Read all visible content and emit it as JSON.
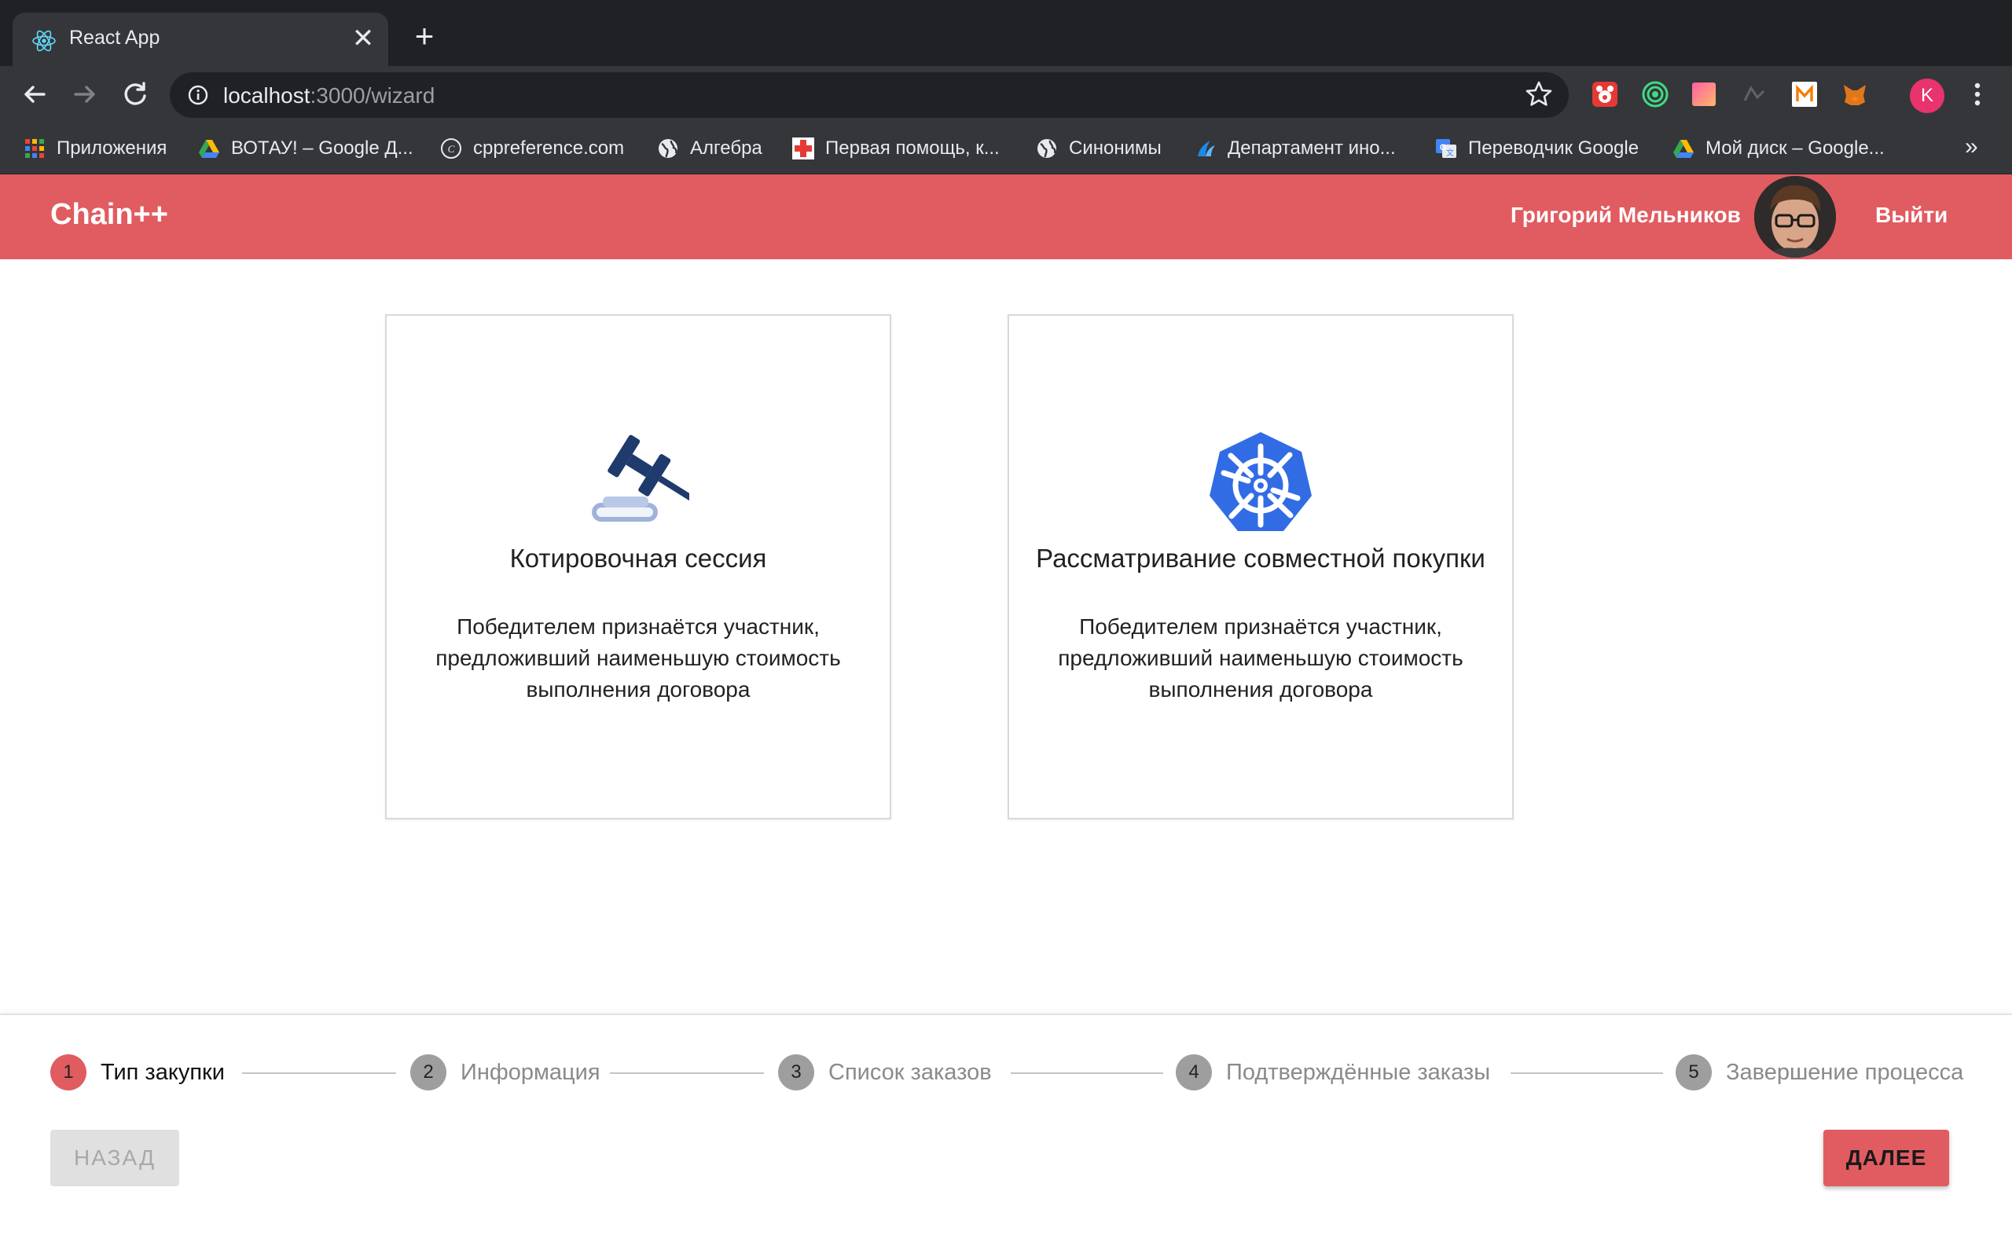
{
  "browser": {
    "tab_title": "React App",
    "close_glyph": "✕",
    "new_tab_glyph": "+",
    "url_host": "localhost",
    "url_rest": ":3000/wizard",
    "profile_initial": "K",
    "bookmarks": [
      {
        "label": "Приложения",
        "icon": "apps-grid-icon"
      },
      {
        "label": "ВОТАУ! – Google Д...",
        "icon": "google-drive-icon"
      },
      {
        "label": "cppreference.com",
        "icon": "cppreference-icon"
      },
      {
        "label": "Алгебра",
        "icon": "globe-icon"
      },
      {
        "label": "Первая помощь, к...",
        "icon": "red-cross-icon"
      },
      {
        "label": "Синонимы",
        "icon": "globe-icon"
      },
      {
        "label": "Департамент ино...",
        "icon": "department-icon"
      },
      {
        "label": "Переводчик Google",
        "icon": "google-translate-icon"
      },
      {
        "label": "Мой диск – Google...",
        "icon": "google-drive-icon"
      }
    ],
    "bookmarks_more": "»"
  },
  "header": {
    "brand": "Chain++",
    "user_name": "Григорий Мельников",
    "logout_label": "Выйти",
    "accent_color": "#e05c61"
  },
  "cards": [
    {
      "icon": "gavel-icon",
      "title": "Котировочная сессия",
      "description": "Победителем признаётся участник, предложивший наименьшую стоимость выполнения договора"
    },
    {
      "icon": "ship-wheel-icon",
      "title": "Рассматривание совместной покупки",
      "description": "Победителем признаётся участник, предложивший наименьшую стоимость выполнения договора"
    }
  ],
  "stepper": {
    "active_step": 1,
    "steps": [
      {
        "num": "1",
        "label": "Тип закупки"
      },
      {
        "num": "2",
        "label": "Информация"
      },
      {
        "num": "3",
        "label": "Список заказов"
      },
      {
        "num": "4",
        "label": "Подтверждённые заказы"
      },
      {
        "num": "5",
        "label": "Завершение процесса"
      }
    ]
  },
  "actions": {
    "back_label": "НАЗАД",
    "next_label": "ДАЛЕЕ"
  }
}
